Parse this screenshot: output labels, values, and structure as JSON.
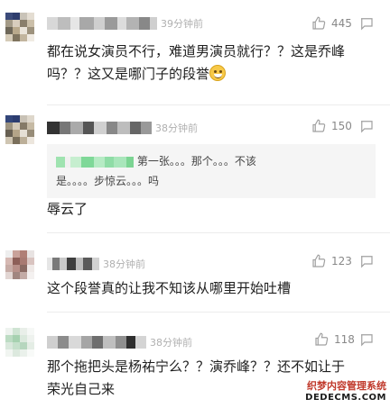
{
  "comments": [
    {
      "time": "39分钟前",
      "likes": "445",
      "text": "都在说女演员不行，难道男演员就行？？这是乔峰吗？？这又是哪门子的段誉",
      "emoji": "grinning-sweat-emoji"
    },
    {
      "time": "38分钟前",
      "likes": "150",
      "quote_lines": [
        "第一张。。。那个。。。不该",
        "是。。。。步惊云。。。吗"
      ],
      "text": "辱云了"
    },
    {
      "time": "38分钟前",
      "likes": "123",
      "text": "这个段誉真的让我不知该从哪里开始吐槽"
    },
    {
      "time": "38分钟前",
      "likes": "118",
      "text_lines": [
        "那个拖把头是杨祐宁么？？演乔峰？？还不如让于",
        "荣光自己来"
      ]
    }
  ],
  "watermark": {
    "line1": "织梦内容管理系统",
    "line2": "DEDECMS.COM"
  },
  "colors": {
    "text": "#1f1f1f",
    "meta": "#b0b0b0",
    "count": "#888888",
    "quote_bg": "#f5f5f5",
    "watermark_red": "#c0392b"
  }
}
